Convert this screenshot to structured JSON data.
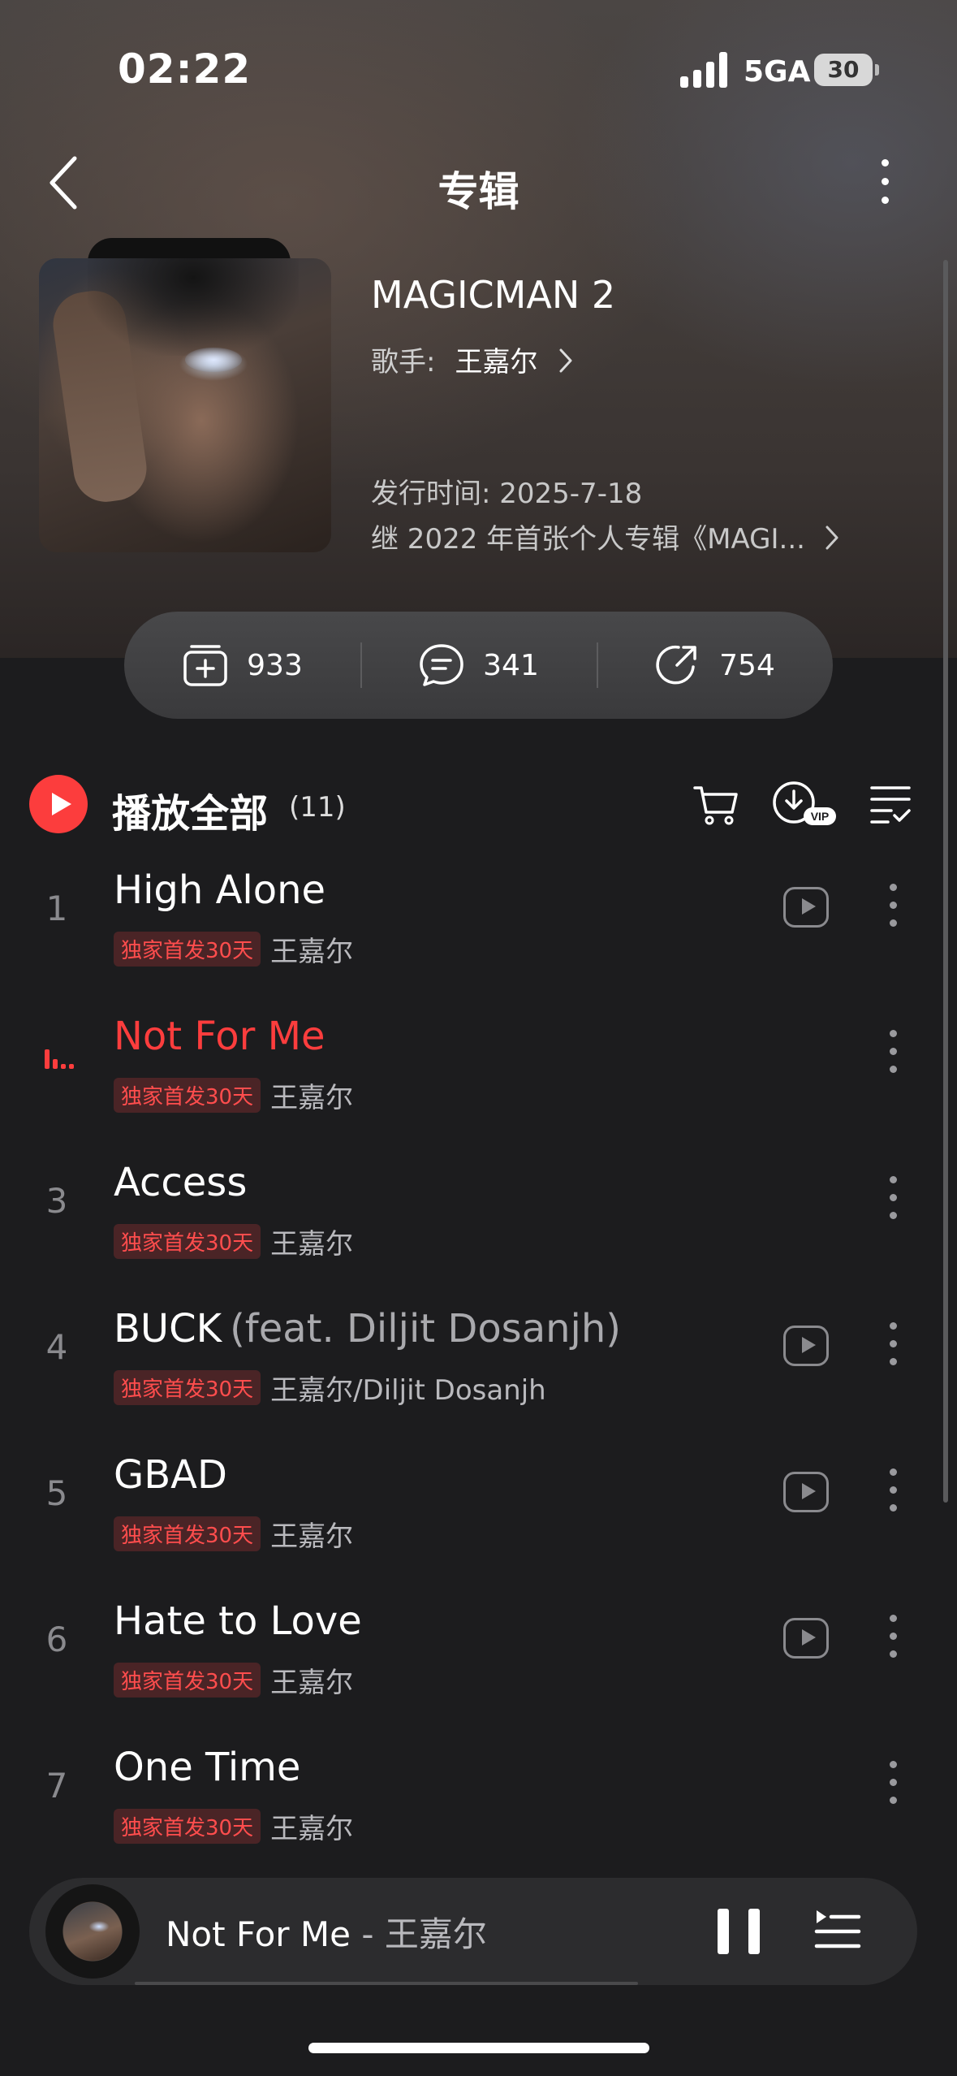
{
  "status_bar": {
    "time": "02:22",
    "network": "5GA",
    "battery": "30"
  },
  "header": {
    "title": "专辑"
  },
  "album": {
    "name": "MAGICMAN 2",
    "artist_label": "歌手:",
    "artist": "王嘉尔",
    "release": "发行时间: 2025-7-18",
    "description": "继 2022 年首张个人专辑《MAGI..."
  },
  "stats": {
    "collect": "933",
    "comments": "341",
    "shares": "754"
  },
  "play_all": {
    "label": "播放全部",
    "count": "(11)"
  },
  "tracks": [
    {
      "num": "1",
      "title": "High Alone",
      "feat": "",
      "badge": "独家首发30天",
      "artist": "王嘉尔",
      "has_video": true,
      "playing": false
    },
    {
      "num": "2",
      "title": "Not For Me",
      "feat": "",
      "badge": "独家首发30天",
      "artist": "王嘉尔",
      "has_video": false,
      "playing": true
    },
    {
      "num": "3",
      "title": "Access",
      "feat": "",
      "badge": "独家首发30天",
      "artist": "王嘉尔",
      "has_video": false,
      "playing": false
    },
    {
      "num": "4",
      "title": "BUCK",
      "feat": "(feat. Diljit Dosanjh)",
      "badge": "独家首发30天",
      "artist": "王嘉尔/Diljit Dosanjh",
      "has_video": true,
      "playing": false
    },
    {
      "num": "5",
      "title": "GBAD",
      "feat": "",
      "badge": "独家首发30天",
      "artist": "王嘉尔",
      "has_video": true,
      "playing": false
    },
    {
      "num": "6",
      "title": "Hate to Love",
      "feat": "",
      "badge": "独家首发30天",
      "artist": "王嘉尔",
      "has_video": true,
      "playing": false
    },
    {
      "num": "7",
      "title": "One Time",
      "feat": "",
      "badge": "独家首发30天",
      "artist": "王嘉尔",
      "has_video": false,
      "playing": false
    }
  ],
  "mini_player": {
    "title": "Not For Me",
    "separator": " - ",
    "artist": "王嘉尔"
  },
  "colors": {
    "accent": "#fc3d3d",
    "background": "#1c1c1e",
    "badge_bg": "#4a2426"
  },
  "icons": [
    "back-arrow-icon",
    "more-icon",
    "collect-icon",
    "comment-icon",
    "share-icon",
    "play-icon",
    "cart-icon",
    "download-vip-icon",
    "multi-select-icon",
    "video-icon",
    "pause-icon",
    "playlist-queue-icon"
  ]
}
